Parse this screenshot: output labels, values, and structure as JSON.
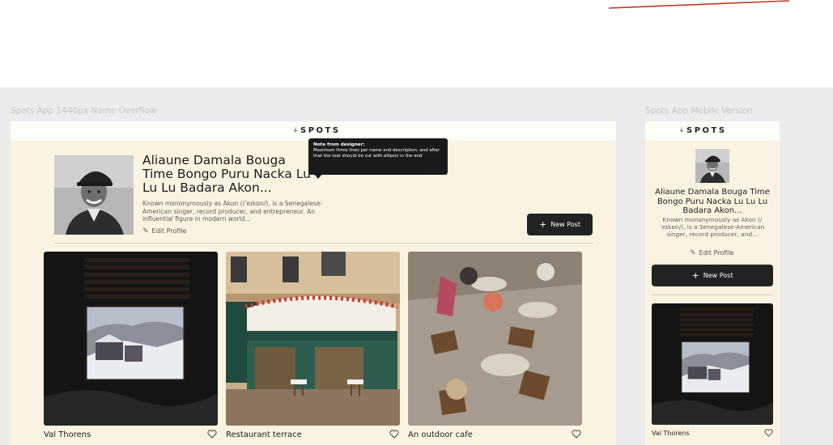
{
  "canvas": {
    "desktop_frame_label": "Spots App 1440px Name Overflow",
    "mobile_frame_label": "Spots App Mobile Version"
  },
  "brand": {
    "logo_mark": "⍭",
    "logo_text": "SPOTS"
  },
  "profile": {
    "name": "Aliaune Damala Bouga Time Bongo Puru Nacka Lu Lu Lu Badara Akon...",
    "description_desktop": "Known mononymously as Akon (/ˈeɪkɒn/), is a Senegalese-American singer, record producer, and entrepreneur. An influential figure in modern world...",
    "description_mobile": "Known mononymously as Akon (/ˈeɪkɒn/), is a Senegalese-American singer, record producer, and...",
    "edit_label": "Edit Profile",
    "new_post_label": "New Post"
  },
  "tooltip": {
    "title": "Note from designer:",
    "body": "Maximum three lines per name and description, and after that the text should be cut with ellipsis in the end"
  },
  "cards": [
    {
      "title": "Val Thorens",
      "image": "window-mountain-view"
    },
    {
      "title": "Restaurant terrace",
      "image": "paris-restaurant-facade"
    },
    {
      "title": "An outdoor cafe",
      "image": "outdoor-cafe-tables"
    }
  ],
  "colors": {
    "frame_bg": "#fbf3e2",
    "button": "#222222",
    "tooltip": "#1a1a1a",
    "canvas": "#ececec"
  }
}
